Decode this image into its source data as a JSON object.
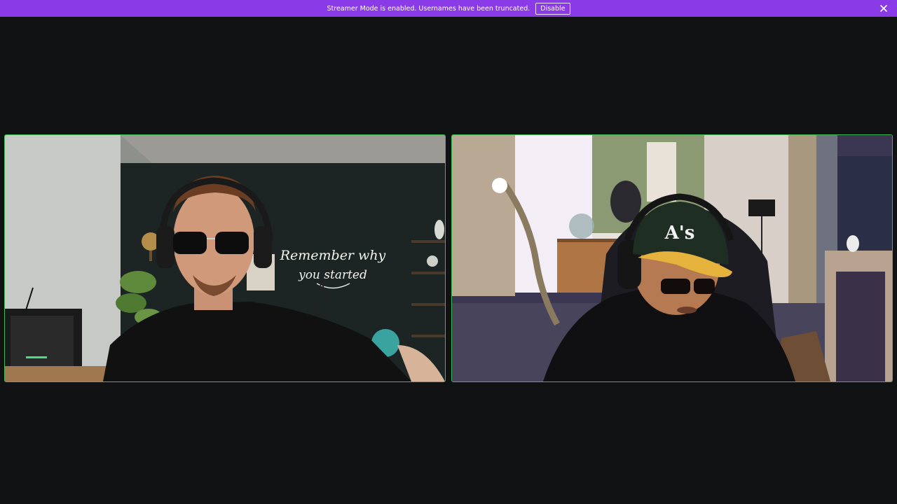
{
  "banner": {
    "message": "Streamer Mode is enabled. Usernames have been truncated.",
    "disable_label": "Disable",
    "background": "#8a3ae6"
  },
  "call": {
    "speaking_border_color": "#3fb950",
    "participants": [
      {
        "neon_sign": [
          "Remember why",
          "you started"
        ]
      },
      {
        "cap_logo": "A's"
      }
    ]
  }
}
